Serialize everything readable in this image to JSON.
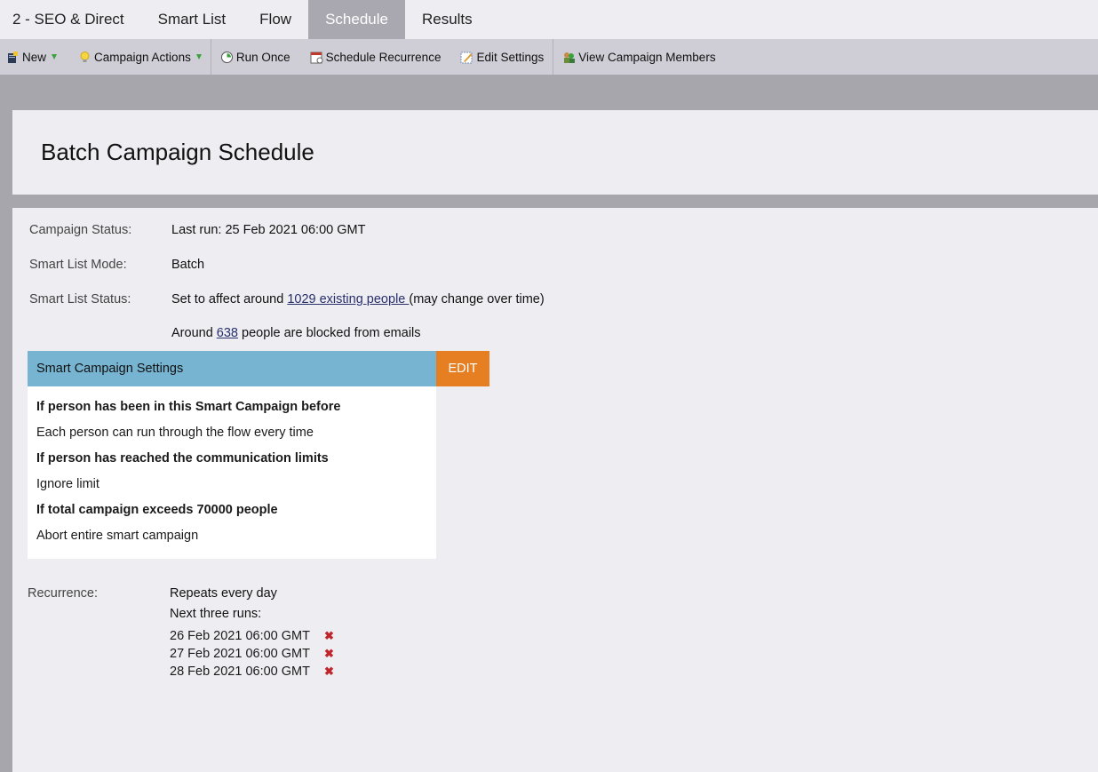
{
  "tabs": [
    "2 - SEO & Direct",
    "Smart List",
    "Flow",
    "Schedule",
    "Results"
  ],
  "active_tab": "Schedule",
  "toolbar": {
    "new_label": "New",
    "campaign_actions_label": "Campaign Actions",
    "run_once_label": "Run Once",
    "schedule_recurrence_label": "Schedule Recurrence",
    "edit_settings_label": "Edit Settings",
    "view_members_label": "View Campaign Members"
  },
  "page": {
    "title": "Batch Campaign Schedule"
  },
  "status": {
    "campaign_status_label": "Campaign Status:",
    "campaign_status_value": "Last run: 25 Feb 2021 06:00 GMT",
    "mode_label": "Smart List Mode:",
    "mode_value": "Batch",
    "list_status_label": "Smart List Status:",
    "list_status_prefix": "Set to affect around ",
    "list_status_link": "1029 existing people ",
    "list_status_suffix": "(may change over time)",
    "blocked_prefix": "Around ",
    "blocked_link": "638",
    "blocked_suffix": " people are blocked from emails"
  },
  "settings": {
    "header": "Smart Campaign Settings",
    "edit_label": "EDIT",
    "lines": [
      {
        "text": "If person has been in this Smart Campaign before",
        "bold": true
      },
      {
        "text": "Each person can run through the flow every time",
        "bold": false
      },
      {
        "text": "If person has reached the communication limits",
        "bold": true
      },
      {
        "text": "Ignore limit",
        "bold": false
      },
      {
        "text": "If total campaign exceeds 70000 people",
        "bold": true
      },
      {
        "text": "Abort entire smart campaign",
        "bold": false
      }
    ]
  },
  "recurrence": {
    "label": "Recurrence:",
    "repeat_text": "Repeats every day",
    "next_runs_label": "Next three runs:",
    "runs": [
      "26 Feb 2021 06:00 GMT",
      "27 Feb 2021 06:00 GMT",
      "28 Feb 2021 06:00 GMT"
    ],
    "delete_glyph": "✖"
  },
  "icons": {
    "new": "new-document-icon",
    "campaign_actions": "lightbulb-icon",
    "run_once": "run-once-clock-icon",
    "schedule_recurrence": "calendar-icon",
    "edit_settings": "edit-pencil-icon",
    "view_members": "campaign-members-icon"
  },
  "colors": {
    "active_tab": "#a9a8b0",
    "settings_header": "#76b4d1",
    "edit_button": "#e67e22",
    "link": "#27306b",
    "delete": "#c0252b"
  }
}
